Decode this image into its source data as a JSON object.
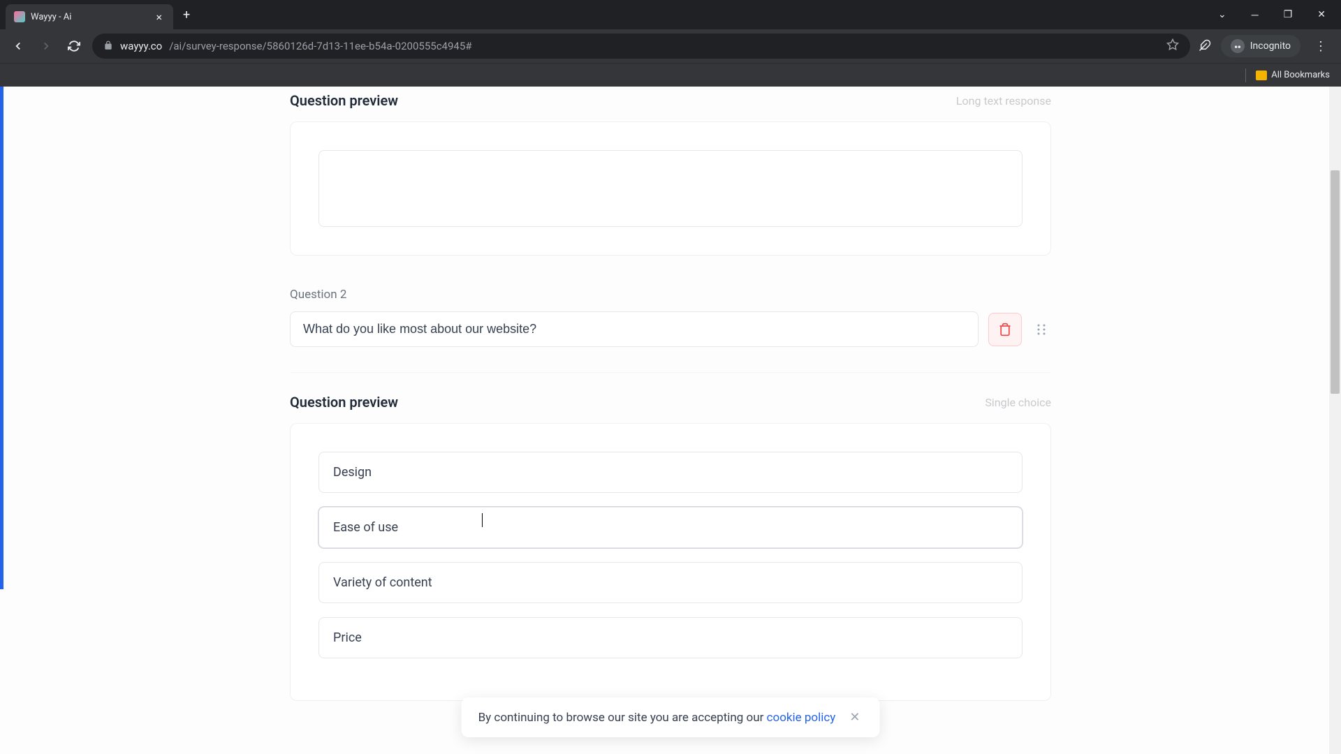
{
  "browser": {
    "tab_title": "Wayyy - Ai",
    "url_host": "wayyy.co",
    "url_path": "/ai/survey-response/5860126d-7d13-11ee-b54a-0200555c4945#",
    "incognito_label": "Incognito",
    "bookmarks_label": "All Bookmarks"
  },
  "q1_preview": {
    "title": "Question preview",
    "type": "Long text response"
  },
  "q2": {
    "label": "Question 2",
    "text": "What do you like most about our website?"
  },
  "q2_preview": {
    "title": "Question preview",
    "type": "Single choice",
    "options": [
      "Design",
      "Ease of use",
      "Variety of content",
      "Price"
    ]
  },
  "cookie": {
    "text": "By continuing to browse our site you are accepting our ",
    "link": "cookie policy"
  }
}
